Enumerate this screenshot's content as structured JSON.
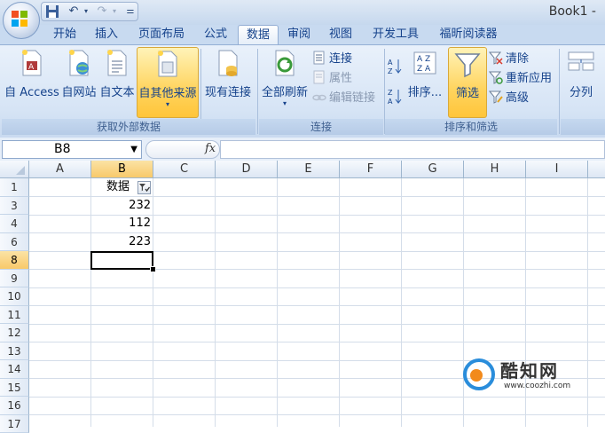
{
  "window": {
    "title": "Book1 -"
  },
  "quick_access": {
    "icons": [
      "save-icon",
      "undo-icon",
      "redo-icon",
      "customize-icon"
    ]
  },
  "tabs": [
    {
      "label": "开始",
      "active": false
    },
    {
      "label": "插入",
      "active": false
    },
    {
      "label": "页面布局",
      "active": false
    },
    {
      "label": "公式",
      "active": false
    },
    {
      "label": "数据",
      "active": true
    },
    {
      "label": "审阅",
      "active": false
    },
    {
      "label": "视图",
      "active": false
    },
    {
      "label": "开发工具",
      "active": false
    },
    {
      "label": "福昕阅读器",
      "active": false
    }
  ],
  "ribbon": {
    "get_external": {
      "label": "获取外部数据",
      "from_access": "自 Access",
      "from_web": "自网站",
      "from_text": "自文本",
      "from_other": "自其他来源",
      "existing": "现有连接"
    },
    "connections": {
      "label": "连接",
      "refresh_all": "全部刷新",
      "connections": "连接",
      "properties": "属性",
      "edit_links": "编辑链接"
    },
    "sort_filter": {
      "label": "排序和筛选",
      "sort": "排序...",
      "filter": "筛选",
      "clear": "清除",
      "reapply": "重新应用",
      "advanced": "高级"
    },
    "data_tools": {
      "text_to_columns": "分列"
    }
  },
  "formula_bar": {
    "name_box": "B8",
    "fx": "fx",
    "formula": ""
  },
  "sheet": {
    "columns": [
      "A",
      "B",
      "C",
      "D",
      "E",
      "F",
      "G",
      "H",
      "I"
    ],
    "rows": [
      "1",
      "3",
      "4",
      "6",
      "8",
      "9",
      "10",
      "11",
      "12",
      "13",
      "14",
      "15",
      "16",
      "17"
    ],
    "header_cell": "数据",
    "values": [
      "232",
      "112",
      "223"
    ],
    "active_cell": "B8"
  },
  "watermark": {
    "name": "酷知网",
    "url": "www.coozhi.com"
  },
  "colors": {
    "accent": "#15428b",
    "ribbon": "#d6e4f5",
    "selected_header": "#f8c96a",
    "watermark_blue": "#2a8ddb",
    "watermark_orange": "#f28a1c"
  }
}
